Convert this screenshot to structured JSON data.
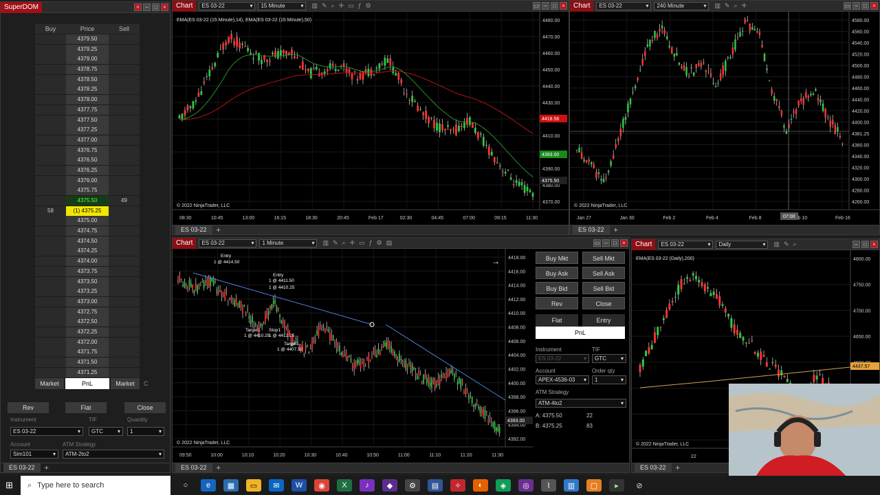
{
  "superdom": {
    "title": "SuperDOM",
    "headers": {
      "buy": "Buy",
      "price": "Price",
      "sell": "Sell"
    },
    "rows": [
      {
        "price": "4379.50"
      },
      {
        "price": "4379.25"
      },
      {
        "price": "4379.00"
      },
      {
        "price": "4378.75"
      },
      {
        "price": "4378.50"
      },
      {
        "price": "4378.25"
      },
      {
        "price": "4378.00"
      },
      {
        "price": "4377.75"
      },
      {
        "price": "4377.50"
      },
      {
        "price": "4377.25"
      },
      {
        "price": "4377.00"
      },
      {
        "price": "4376.75"
      },
      {
        "price": "4376.50"
      },
      {
        "price": "4376.25"
      },
      {
        "price": "4376.00"
      },
      {
        "price": "4375.75"
      },
      {
        "price": "4375.50",
        "sell": "49",
        "kind": "ask"
      },
      {
        "price": "(1) 4375.25",
        "buy": "58",
        "kind": "cur"
      },
      {
        "price": "4375.00"
      },
      {
        "price": "4374.75"
      },
      {
        "price": "4374.50"
      },
      {
        "price": "4374.25"
      },
      {
        "price": "4374.00"
      },
      {
        "price": "4373.75"
      },
      {
        "price": "4373.50"
      },
      {
        "price": "4373.25"
      },
      {
        "price": "4373.00"
      },
      {
        "price": "4372.75"
      },
      {
        "price": "4372.50"
      },
      {
        "price": "4372.25"
      },
      {
        "price": "4372.00"
      },
      {
        "price": "4371.75"
      },
      {
        "price": "4371.50"
      },
      {
        "price": "4371.25"
      }
    ],
    "market_buy": "Market",
    "pnl": "PnL",
    "market_sell": "Market",
    "c_label": "C",
    "rev": "Rev",
    "flat": "Flat",
    "close": "Close",
    "instrument_label": "Instrument",
    "tif_label": "TIF",
    "quantity_label": "Quantity",
    "instrument": "ES 03-22",
    "tif": "GTC",
    "quantity": "1",
    "account_label": "Account",
    "atm_label": "ATM Strategy",
    "account": "Sim101",
    "atm": "ATM-2to2",
    "tab": "ES 03-22"
  },
  "chart1": {
    "title": "Chart",
    "instrument": "ES 03-22",
    "interval": "15 Minute",
    "indicator_label": "EMA(ES 03-22 (15 Minute),14), EMA(ES 03-22 (15 Minute),50)",
    "copyright": "© 2022 NinjaTrader, LLC",
    "y_ticks": [
      "4480.00",
      "4470.00",
      "4460.00",
      "4450.00",
      "4440.00",
      "4430.00",
      "4420.00",
      "4410.00",
      "4400.00",
      "4390.00",
      "4380.00",
      "4370.00"
    ],
    "x_ticks": [
      "08:30",
      "10:45",
      "13:00",
      "16:15",
      "18:30",
      "20:45",
      "Feb 17",
      "02:30",
      "04:45",
      "07:00",
      "09:15",
      "11:30"
    ],
    "price_tags": [
      "4418.56",
      "4393.00",
      "4375.50"
    ],
    "tab": "ES 03-22"
  },
  "chart2": {
    "title": "Chart",
    "instrument": "ES 03-22",
    "interval": "240 Minute",
    "copyright": "© 2022 NinjaTrader, LLC",
    "y_ticks": [
      "4580.00",
      "4560.00",
      "4540.00",
      "4520.00",
      "4500.00",
      "4480.00",
      "4460.00",
      "4440.00",
      "4420.00",
      "4400.00",
      "4381.25",
      "4360.00",
      "4340.00",
      "4320.00",
      "4300.00",
      "4280.00",
      "4260.00"
    ],
    "x_ticks": [
      "Jan 27",
      "Jan 30",
      "Feb 2",
      "Feb 4",
      "Feb 8",
      "Feb 10",
      "Feb 16"
    ],
    "crosshair_time": "07:00",
    "tab": "ES 03-22"
  },
  "chart3": {
    "title": "Chart",
    "instrument": "ES 03-22",
    "interval": "1 Minute",
    "copyright": "© 2022 NinjaTrader, LLC",
    "y_ticks": [
      "4418.00",
      "4416.00",
      "4414.00",
      "4412.00",
      "4410.00",
      "4408.00",
      "4406.00",
      "4404.00",
      "4402.00",
      "4400.00",
      "4398.00",
      "4396.00",
      "4394.00",
      "4392.00"
    ],
    "x_ticks": [
      "09:50",
      "10:00",
      "10:10",
      "10:20",
      "10:30",
      "10:40",
      "10:50",
      "11:00",
      "11:10",
      "11:20",
      "11:30"
    ],
    "annotations": [
      "Entry",
      "1 @ 4414.50",
      "Entry",
      "1 @ 4411.50",
      "1 @ 4410.25",
      "Target1",
      "1 @ 4410.25",
      "Stop1",
      "1 @ 4412.25",
      "Target1",
      "1 @ 4407.50"
    ],
    "price_tags": [
      "4393.00"
    ],
    "tab": "ES 03-22"
  },
  "chart_trader": {
    "buy_mkt": "Buy Mkt",
    "sell_mkt": "Sell Mkt",
    "buy_ask": "Buy Ask",
    "sell_ask": "Sell Ask",
    "buy_bid": "Buy Bid",
    "sell_bid": "Sell Bid",
    "rev": "Rev",
    "close": "Close",
    "flat": "Flat",
    "entry": "Entry",
    "pnl": "PnL",
    "instrument_label": "Instrument",
    "tif_label": "TIF",
    "instrument": "ES 03-22",
    "tif": "GTC",
    "account_label": "Account",
    "order_qty_label": "Order qty",
    "account": "APEX-4536-03",
    "order_qty": "1",
    "atm_label": "ATM Strategy",
    "atm": "ATM-4to2",
    "ask_line": "A:  4375.50",
    "ask_size": "22",
    "bid_line": "B:  4375.25",
    "bid_size": "83"
  },
  "chart4": {
    "title": "Chart",
    "instrument": "ES 03-22",
    "interval": "Daily",
    "indicator_label": "EMA(ES 03-22 (Daily),200)",
    "copyright": "© 2022 NinjaTrader, LLC",
    "y_ticks": [
      "4800.00",
      "4750.00",
      "4700.00",
      "4650.00",
      "4600.00",
      "4550.00",
      "4500.00",
      "4450.00"
    ],
    "price_tag": "4437.57",
    "x_tick": "22",
    "tab": "ES 03-22"
  },
  "taskbar": {
    "search_placeholder": "Type here to search"
  }
}
